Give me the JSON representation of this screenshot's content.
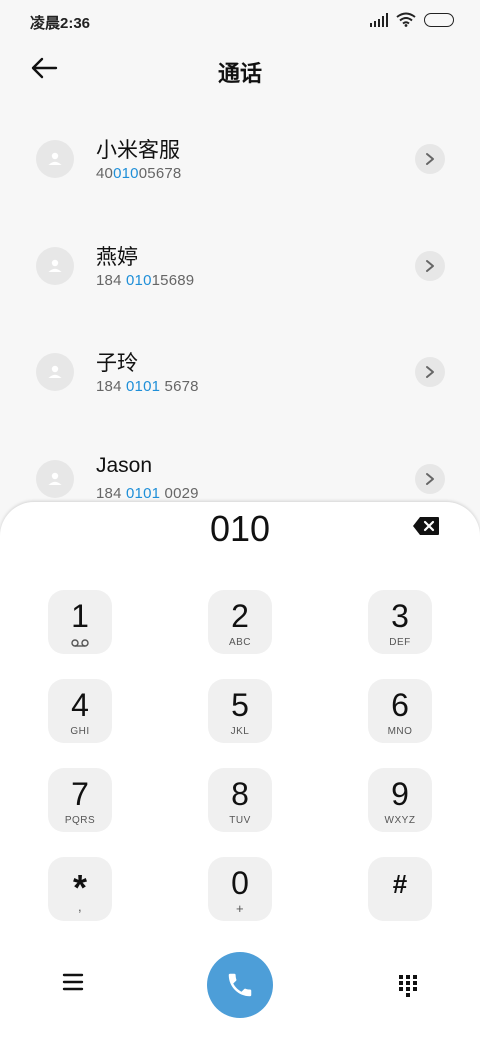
{
  "status": {
    "time": "凌晨2:36"
  },
  "header": {
    "title": "通话"
  },
  "contacts": [
    {
      "name": "小米客服",
      "num_a": "40",
      "num_hl": "010",
      "num_b": "05678"
    },
    {
      "name": "燕婷",
      "num_a": "184 ",
      "num_hl": "010",
      "num_b": "15689"
    },
    {
      "name": "子玲",
      "num_a": "184 ",
      "num_hl": "0101",
      "num_b": " 5678"
    },
    {
      "name": "Jason",
      "num_a": "184 ",
      "num_hl": "0101",
      "num_b": " 0029"
    }
  ],
  "dialer": {
    "input": "010",
    "keys": [
      {
        "digit": "1",
        "letters": ""
      },
      {
        "digit": "2",
        "letters": "ABC"
      },
      {
        "digit": "3",
        "letters": "DEF"
      },
      {
        "digit": "4",
        "letters": "GHI"
      },
      {
        "digit": "5",
        "letters": "JKL"
      },
      {
        "digit": "6",
        "letters": "MNO"
      },
      {
        "digit": "7",
        "letters": "PQRS"
      },
      {
        "digit": "8",
        "letters": "TUV"
      },
      {
        "digit": "9",
        "letters": "WXYZ"
      },
      {
        "digit": "*",
        "letters": ","
      },
      {
        "digit": "0",
        "letters": "+"
      },
      {
        "digit": "#",
        "letters": ""
      }
    ]
  },
  "colors": {
    "accent": "#1f8fd8",
    "call_button": "#4d9ed8",
    "key_bg": "#f0f0f0"
  },
  "icons": {
    "back": "arrow-left-icon",
    "delete": "backspace-icon",
    "menu": "hamburger-icon",
    "call": "phone-icon",
    "keypad": "dialpad-icon",
    "voicemail": "voicemail-icon"
  }
}
